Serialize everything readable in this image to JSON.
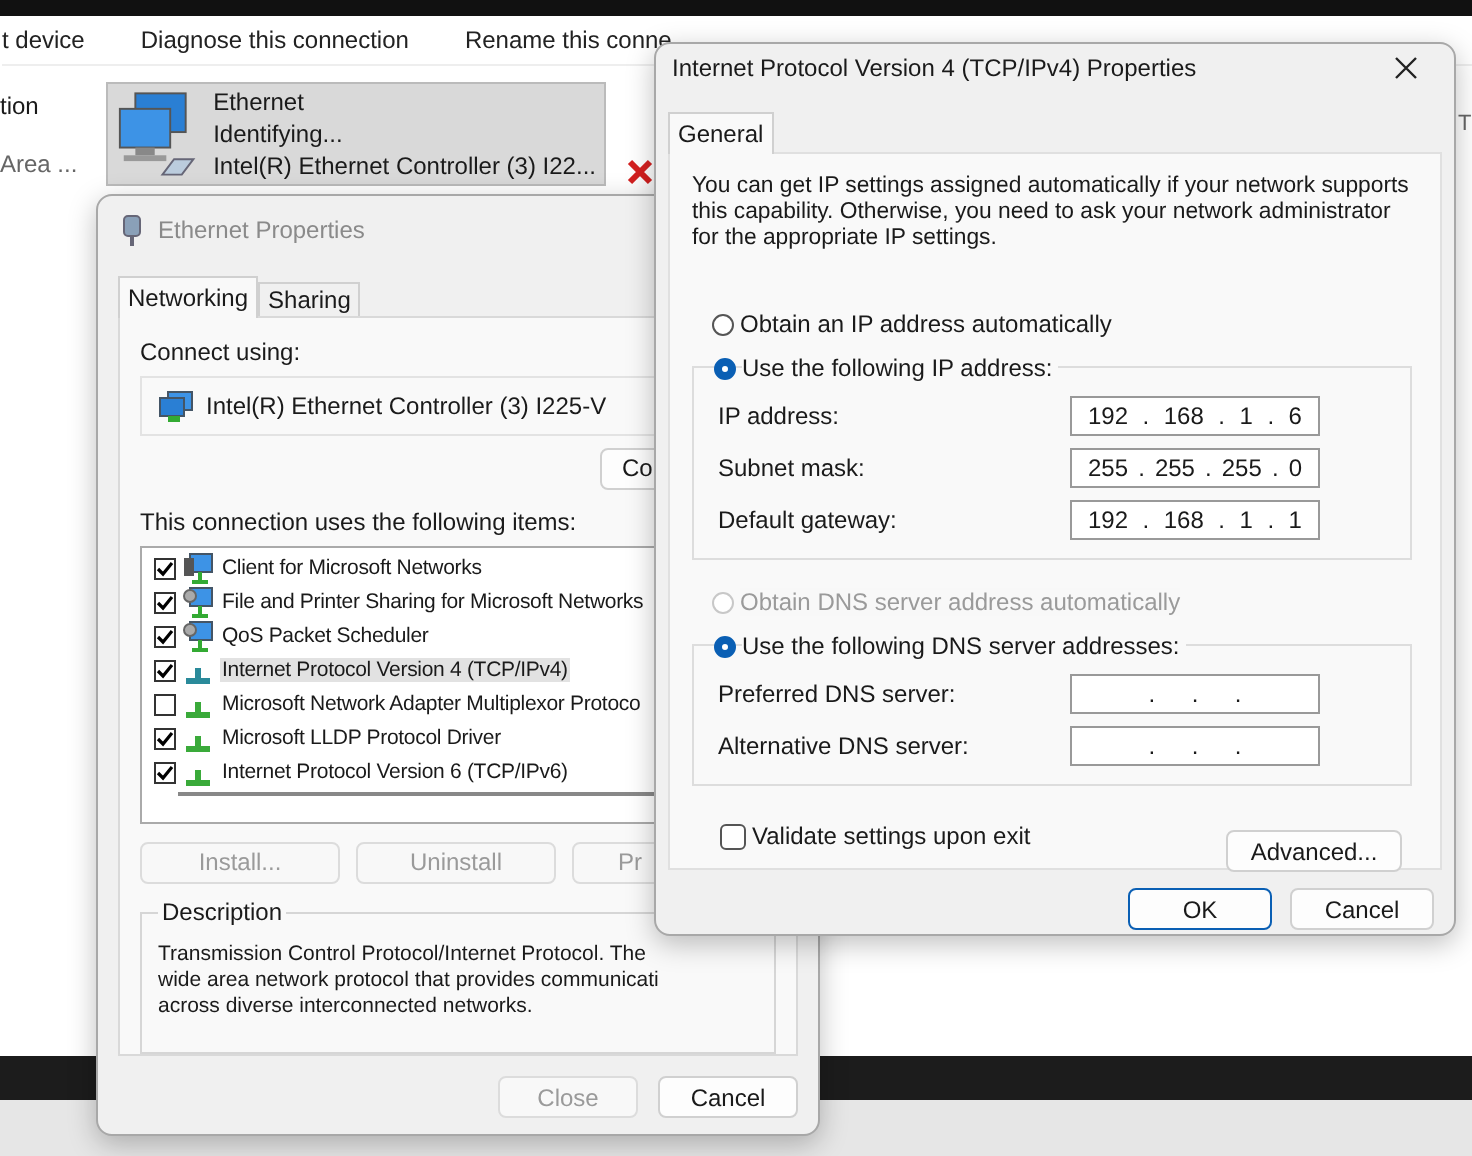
{
  "explorer": {
    "toolbar": [
      "t device",
      "Diagnose this connection",
      "Rename this conne"
    ],
    "side": [
      "tion",
      "Area ..."
    ],
    "adapter": {
      "name": "Ethernet",
      "status": "Identifying...",
      "device": "Intel(R) Ethernet Controller (3) I22...",
      "selected": true
    },
    "edge_text": "T"
  },
  "ethernet_properties": {
    "title": "Ethernet Properties",
    "tabs": [
      {
        "label": "Networking",
        "selected": true
      },
      {
        "label": "Sharing",
        "selected": false
      }
    ],
    "connect_using_label": "Connect using:",
    "adapter": "Intel(R) Ethernet Controller (3) I225-V",
    "configure_button": "Co",
    "items_label": "This connection uses the following items:",
    "items": [
      {
        "kind": "client",
        "label": "Client for Microsoft Networks",
        "checked": true,
        "selected": false
      },
      {
        "kind": "service",
        "label": "File and Printer Sharing for Microsoft Networks",
        "checked": true,
        "selected": false
      },
      {
        "kind": "service",
        "label": "QoS Packet Scheduler",
        "checked": true,
        "selected": false
      },
      {
        "kind": "protocol",
        "label": "Internet Protocol Version 4 (TCP/IPv4)",
        "checked": true,
        "selected": true
      },
      {
        "kind": "protocol",
        "label": "Microsoft Network Adapter Multiplexor Protoco",
        "checked": false,
        "selected": false
      },
      {
        "kind": "protocol",
        "label": "Microsoft LLDP Protocol Driver",
        "checked": true,
        "selected": false
      },
      {
        "kind": "protocol",
        "label": "Internet Protocol Version 6 (TCP/IPv6)",
        "checked": true,
        "selected": false
      }
    ],
    "item_buttons": [
      {
        "label": "Install...",
        "disabled": true
      },
      {
        "label": "Uninstall",
        "disabled": true
      },
      {
        "label": "Pr",
        "disabled": true
      }
    ],
    "description": {
      "title": "Description",
      "lines": [
        "Transmission Control Protocol/Internet Protocol. The",
        "wide area network protocol that provides communicati",
        "across diverse interconnected networks."
      ]
    },
    "footer": [
      {
        "label": "Close",
        "disabled": true
      },
      {
        "label": "Cancel",
        "disabled": false
      }
    ]
  },
  "ipv4_properties": {
    "title": "Internet Protocol Version 4 (TCP/IPv4) Properties",
    "tabs": [
      {
        "label": "General",
        "selected": true
      }
    ],
    "intro": "You can get IP settings assigned automatically if your network supports this capability. Otherwise, you need to ask your network administrator for the appropriate IP settings.",
    "sections": [
      {
        "auto_option": {
          "label": "Obtain an IP address automatically",
          "selected": false,
          "disabled": false
        },
        "manual_option": {
          "label": "Use the following IP address:",
          "selected": true,
          "disabled": false
        },
        "fields": [
          {
            "label": "IP address:",
            "parts": [
              "192",
              ".",
              "168",
              ".",
              "1",
              ".",
              "6"
            ]
          },
          {
            "label": "Subnet mask:",
            "parts": [
              "255",
              ".",
              "255",
              ".",
              "255",
              ".",
              "0"
            ]
          },
          {
            "label": "Default gateway:",
            "parts": [
              "192",
              ".",
              "168",
              ".",
              "1",
              ".",
              "1"
            ]
          }
        ]
      },
      {
        "auto_option": {
          "label": "Obtain DNS server address automatically",
          "selected": false,
          "disabled": true
        },
        "manual_option": {
          "label": "Use the following DNS server addresses:",
          "selected": true,
          "disabled": false
        },
        "fields": [
          {
            "label": "Preferred DNS server:",
            "parts": [
              ".",
              ".",
              "."
            ]
          },
          {
            "label": "Alternative DNS server:",
            "parts": [
              ".",
              ".",
              "."
            ]
          }
        ]
      }
    ],
    "validate": {
      "label": "Validate settings upon exit",
      "checked": false
    },
    "advanced_button": "Advanced...",
    "footer": [
      {
        "label": "OK",
        "default": true
      },
      {
        "label": "Cancel",
        "default": false
      }
    ]
  }
}
